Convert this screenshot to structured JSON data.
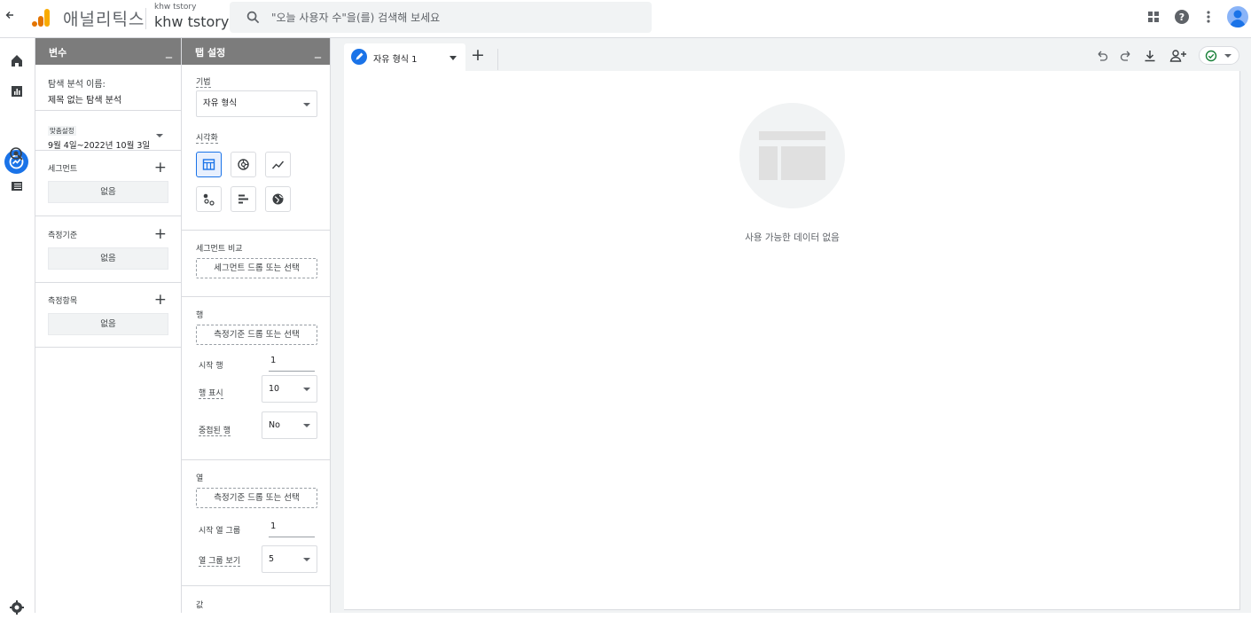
{
  "header": {
    "brand": "애널리틱스",
    "account_small": "khw tstory",
    "account_big": "khw tstory",
    "search_placeholder": "\"오늘 사용자 수\"을(를) 검색해 보세요"
  },
  "variables_panel": {
    "title": "변수",
    "minimize": "_",
    "exploration_name_label": "탐색 분석 이름:",
    "exploration_name": "제목 없는 탐색 분석",
    "date_badge": "맞춤설정",
    "date_range": "9월 4일~2022년 10월 3일",
    "segments_label": "세그먼트",
    "segments_value": "없음",
    "dimensions_label": "측정기준",
    "dimensions_value": "없음",
    "metrics_label": "측정항목",
    "metrics_value": "없음",
    "plus": "+"
  },
  "tab_settings": {
    "title": "탭 설정",
    "minimize": "_",
    "technique_label": "기법",
    "technique_value": "자유 형식",
    "visualization_label": "시각화",
    "segment_compare_label": "세그먼트 비교",
    "segment_drop": "세그먼트 드롭 또는 선택",
    "rows_label": "행",
    "rows_drop": "측정기준 드롭 또는 선택",
    "start_row_label": "시작 행",
    "start_row_value": "1",
    "show_rows_label": "행 표시",
    "show_rows_value": "10",
    "nested_rows_label": "중첩된 행",
    "nested_rows_value": "No",
    "columns_label": "열",
    "columns_drop": "측정기준 드롭 또는 선택",
    "start_col_group_label": "시작 열 그룹",
    "start_col_group_value": "1",
    "show_col_groups_label": "열 그룹 보기",
    "show_col_groups_value": "5",
    "values_label": "값"
  },
  "canvas": {
    "tab_label": "자유 형식 1",
    "add_tab": "+",
    "empty_message": "사용 가능한 데이터 없음"
  },
  "colors": {
    "accent": "#1a73e8",
    "panel_header": "#7c7c7c",
    "canvas_bg": "#f1f3f4"
  }
}
